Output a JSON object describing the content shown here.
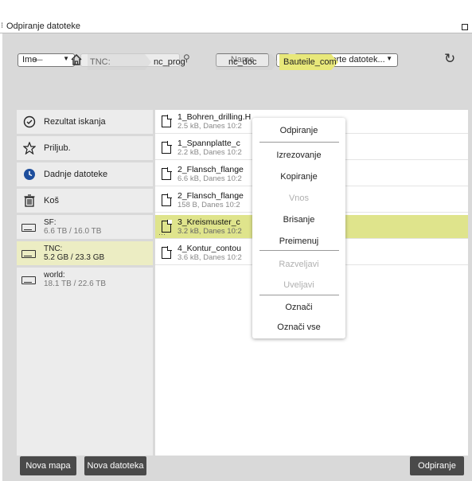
{
  "window": {
    "title": "Odpiranje datoteke"
  },
  "toolbar": {
    "sort_select": "Ime",
    "name_button": "Name",
    "sort_dir": "↑",
    "filter_select": "Vse podprte datotek..."
  },
  "breadcrumb": {
    "drive": "TNC:",
    "items": [
      "nc_prog",
      "nc_doc",
      "Bauteile_com..."
    ]
  },
  "sidebar": {
    "items": [
      {
        "label": "Rezultat iskanja"
      },
      {
        "label": "Priljub."
      },
      {
        "label": "Dadnje datoteke"
      },
      {
        "label": "Koš"
      },
      {
        "label": "SF:",
        "sub": "6.6 TB / 16.0 TB"
      },
      {
        "label": "TNC:",
        "sub": "5.2 GB / 23.3 GB"
      },
      {
        "label": "world:",
        "sub": "18.1 TB / 22.6 TB"
      }
    ]
  },
  "files": [
    {
      "name": "1_Bohren_drilling.H",
      "meta": "2.5 kB, Danes 10:2"
    },
    {
      "name": "1_Spannplatte_c",
      "meta": "2.2 kB, Danes 10:2"
    },
    {
      "name": "2_Flansch_flange",
      "meta": "6.6 kB, Danes 10:2"
    },
    {
      "name": "2_Flansch_flange",
      "meta": "158 B, Danes 10:2"
    },
    {
      "name": "3_Kreismuster_c",
      "meta": "3.2 kB, Danes 10:2"
    },
    {
      "name": "4_Kontur_contou",
      "meta": "3.6 kB, Danes 10:2"
    }
  ],
  "context_menu": {
    "items": [
      {
        "label": "Odpiranje",
        "enabled": true
      },
      {
        "label": "Izrezovanje",
        "enabled": true
      },
      {
        "label": "Kopiranje",
        "enabled": true
      },
      {
        "label": "Vnos",
        "enabled": false
      },
      {
        "label": "Brisanje",
        "enabled": true
      },
      {
        "label": "Preimenuj",
        "enabled": true
      },
      {
        "label": "Razveljavi",
        "enabled": false
      },
      {
        "label": "Uveljavi",
        "enabled": false
      },
      {
        "label": "Označi",
        "enabled": true
      },
      {
        "label": "Označi vse",
        "enabled": true
      }
    ]
  },
  "footer": {
    "new_folder": "Nova mapa",
    "new_file": "Nova datoteka",
    "open": "Odpiranje"
  },
  "colors": {
    "selected_row": "#dfe48c",
    "active_crumb": "#e8e87a",
    "sidebar_active": "#ecedc3",
    "footer_button": "#4a4a4a"
  }
}
